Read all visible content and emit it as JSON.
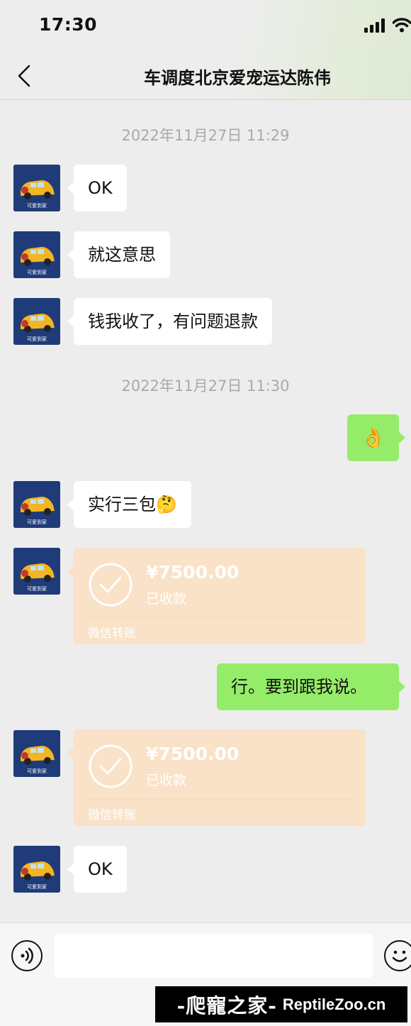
{
  "status_bar": {
    "time": "17:30"
  },
  "header": {
    "title": "车调度北京爱宠运达陈伟"
  },
  "avatar_caption": "可爱到家",
  "messages": [
    {
      "type": "timestamp",
      "text": "2022年11月27日 11:29"
    },
    {
      "type": "text",
      "side": "left",
      "text": "OK"
    },
    {
      "type": "text",
      "side": "left",
      "text": "就这意思"
    },
    {
      "type": "text",
      "side": "left",
      "text": "钱我收了，有问题退款"
    },
    {
      "type": "timestamp",
      "text": "2022年11月27日 11:30"
    },
    {
      "type": "emoji",
      "side": "right",
      "icon": "ok-hand-icon",
      "text": "👌"
    },
    {
      "type": "text",
      "side": "left",
      "text": "实行三包🤔"
    },
    {
      "type": "transfer",
      "side": "left",
      "amount": "¥7500.00",
      "status": "已收款",
      "footer": "微信转账"
    },
    {
      "type": "text",
      "side": "right",
      "text": "行。要到跟我说。"
    },
    {
      "type": "transfer",
      "side": "left",
      "amount": "¥7500.00",
      "status": "已收款",
      "footer": "微信转账"
    },
    {
      "type": "text",
      "side": "left",
      "text": "OK"
    }
  ],
  "input_bar": {
    "placeholder": ""
  },
  "watermark": {
    "cn": "-爬寵之家-",
    "en": "ReptileZoo.cn"
  },
  "colors": {
    "background": "#ededed",
    "bubble_self": "#95ec69",
    "bubble_other": "#ffffff",
    "transfer_card": "#f9e2c7",
    "avatar_bg": "#1f3b79"
  }
}
